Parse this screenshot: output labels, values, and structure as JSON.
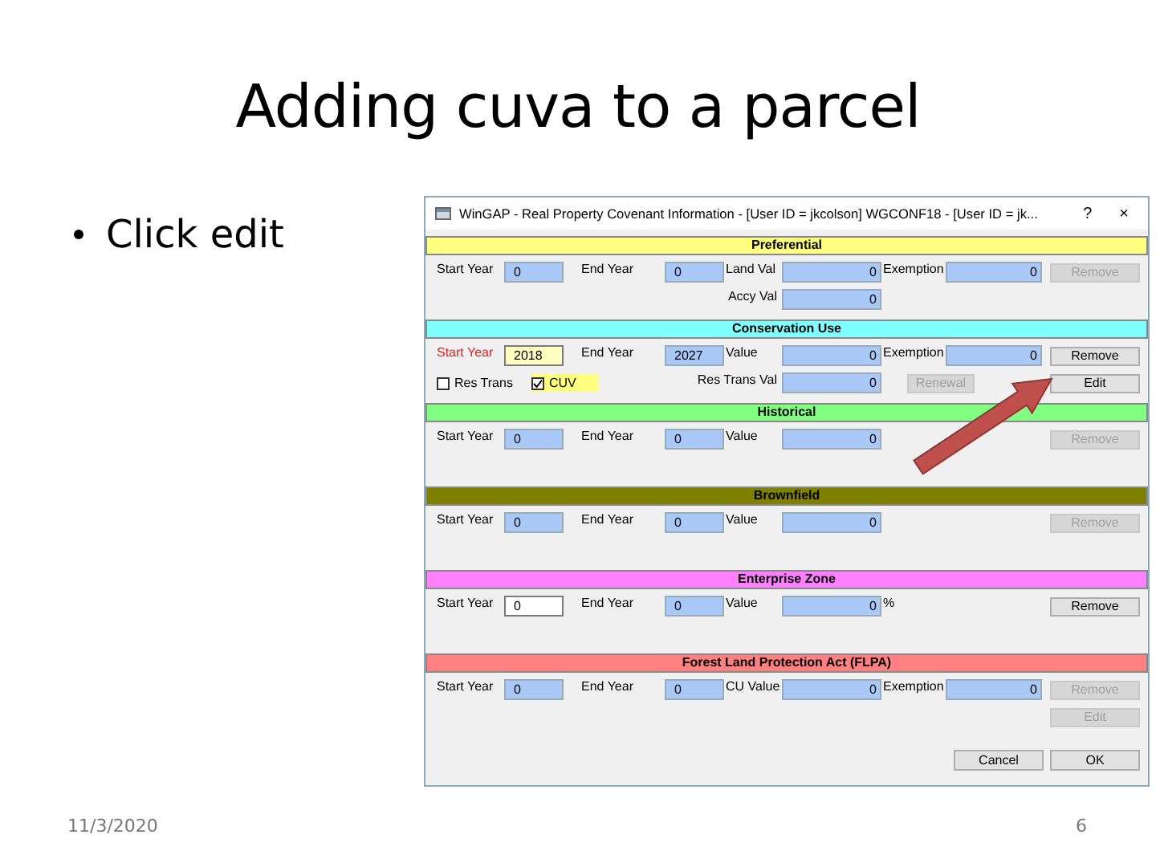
{
  "slide": {
    "title": "Adding cuva to a parcel",
    "bullets": [
      "Click edit"
    ],
    "date": "11/3/2020",
    "page_number": "6"
  },
  "window": {
    "title": "WinGAP - Real Property Covenant Information - [User ID = jkcolson] WGCONF18 - [User ID = jk...",
    "help": "?",
    "close": "×"
  },
  "sections": [
    {
      "title": "Preferential",
      "color": "#ffff80",
      "rows": [
        [
          {
            "kind": "label",
            "text": "Start Year",
            "alert": false
          },
          {
            "kind": "field",
            "value": "0",
            "readonly": true,
            "focused": false
          },
          {
            "kind": "label",
            "text": "End Year",
            "alert": false
          },
          {
            "kind": "field",
            "value": "0",
            "readonly": true,
            "focused": false
          },
          {
            "kind": "label",
            "text": "Land Val",
            "alert": false
          },
          {
            "kind": "field",
            "value": "0",
            "readonly": true,
            "focused": false
          },
          {
            "kind": "label",
            "text": "Exemption",
            "alert": false
          },
          {
            "kind": "field",
            "value": "0",
            "readonly": true,
            "focused": false
          },
          {
            "kind": "button",
            "text": "Remove",
            "disabled": true
          }
        ],
        [
          null,
          null,
          null,
          null,
          {
            "kind": "label",
            "text": "Accy Val",
            "alert": false
          },
          {
            "kind": "field",
            "value": "0",
            "readonly": true,
            "focused": false
          },
          null,
          null,
          null
        ]
      ]
    },
    {
      "title": "Conservation Use",
      "color": "#80ffff",
      "rows": [
        [
          {
            "kind": "label",
            "text": "Start Year",
            "alert": true
          },
          {
            "kind": "field",
            "value": "2018",
            "readonly": false,
            "focused": true
          },
          {
            "kind": "label",
            "text": "End Year",
            "alert": false
          },
          {
            "kind": "field",
            "value": "2027",
            "readonly": true,
            "focused": false
          },
          {
            "kind": "label",
            "text": "Value",
            "alert": false
          },
          {
            "kind": "field",
            "value": "0",
            "readonly": true,
            "focused": false
          },
          {
            "kind": "label",
            "text": "Exemption",
            "alert": false
          },
          {
            "kind": "field",
            "value": "0",
            "readonly": true,
            "focused": false
          },
          {
            "kind": "button",
            "text": "Remove",
            "disabled": false
          }
        ],
        [
          {
            "kind": "checkbox",
            "text": "Res Trans",
            "checked": false,
            "highlighted": false
          },
          {
            "kind": "checkbox",
            "text": "CUV",
            "checked": true,
            "highlighted": true
          },
          null,
          null,
          {
            "kind": "label",
            "text": "Res Trans Val",
            "alert": false
          },
          {
            "kind": "field",
            "value": "0",
            "readonly": true,
            "focused": false
          },
          {
            "kind": "button",
            "text": "Renewal",
            "disabled": true
          },
          null,
          {
            "kind": "button",
            "text": "Edit",
            "disabled": false
          }
        ]
      ]
    },
    {
      "title": "Historical",
      "color": "#80ff80",
      "rows": [
        [
          {
            "kind": "label",
            "text": "Start Year",
            "alert": false
          },
          {
            "kind": "field",
            "value": "0",
            "readonly": true,
            "focused": false
          },
          {
            "kind": "label",
            "text": "End Year",
            "alert": false
          },
          {
            "kind": "field",
            "value": "0",
            "readonly": true,
            "focused": false
          },
          {
            "kind": "label",
            "text": "Value",
            "alert": false
          },
          {
            "kind": "field",
            "value": "0",
            "readonly": true,
            "focused": false
          },
          null,
          null,
          {
            "kind": "button",
            "text": "Remove",
            "disabled": true
          }
        ]
      ]
    },
    {
      "title": "Brownfield",
      "color": "#808000",
      "rows": [
        [
          {
            "kind": "label",
            "text": "Start Year",
            "alert": false
          },
          {
            "kind": "field",
            "value": "0",
            "readonly": true,
            "focused": false
          },
          {
            "kind": "label",
            "text": "End Year",
            "alert": false
          },
          {
            "kind": "field",
            "value": "0",
            "readonly": true,
            "focused": false
          },
          {
            "kind": "label",
            "text": "Value",
            "alert": false
          },
          {
            "kind": "field",
            "value": "0",
            "readonly": true,
            "focused": false
          },
          null,
          null,
          {
            "kind": "button",
            "text": "Remove",
            "disabled": true
          }
        ]
      ]
    },
    {
      "title": "Enterprise Zone",
      "color": "#ff80ff",
      "rows": [
        [
          {
            "kind": "label",
            "text": "Start Year",
            "alert": false
          },
          {
            "kind": "field",
            "value": "0",
            "readonly": false,
            "focused": false
          },
          {
            "kind": "label",
            "text": "End Year",
            "alert": false
          },
          {
            "kind": "field",
            "value": "0",
            "readonly": true,
            "focused": false
          },
          {
            "kind": "label",
            "text": "Value",
            "alert": false
          },
          {
            "kind": "field",
            "value": "0",
            "readonly": true,
            "focused": false
          },
          {
            "kind": "label",
            "text": "%",
            "alert": false
          },
          null,
          {
            "kind": "button",
            "text": "Remove",
            "disabled": false
          }
        ]
      ]
    },
    {
      "title": "Forest Land Protection Act (FLPA)",
      "color": "#ff8080",
      "rows": [
        [
          {
            "kind": "label",
            "text": "Start Year",
            "alert": false
          },
          {
            "kind": "field",
            "value": "0",
            "readonly": true,
            "focused": false
          },
          {
            "kind": "label",
            "text": "End Year",
            "alert": false
          },
          {
            "kind": "field",
            "value": "0",
            "readonly": true,
            "focused": false
          },
          {
            "kind": "label",
            "text": "CU Value",
            "alert": false
          },
          {
            "kind": "field",
            "value": "0",
            "readonly": true,
            "focused": false
          },
          {
            "kind": "label",
            "text": "Exemption",
            "alert": false
          },
          {
            "kind": "field",
            "value": "0",
            "readonly": true,
            "focused": false
          },
          {
            "kind": "button",
            "text": "Remove",
            "disabled": true
          }
        ],
        [
          null,
          null,
          null,
          null,
          null,
          null,
          null,
          null,
          {
            "kind": "button",
            "text": "Edit",
            "disabled": true
          }
        ]
      ]
    }
  ],
  "dialog_buttons": [
    {
      "text": "Cancel",
      "disabled": false
    },
    {
      "text": "OK",
      "disabled": false
    }
  ]
}
